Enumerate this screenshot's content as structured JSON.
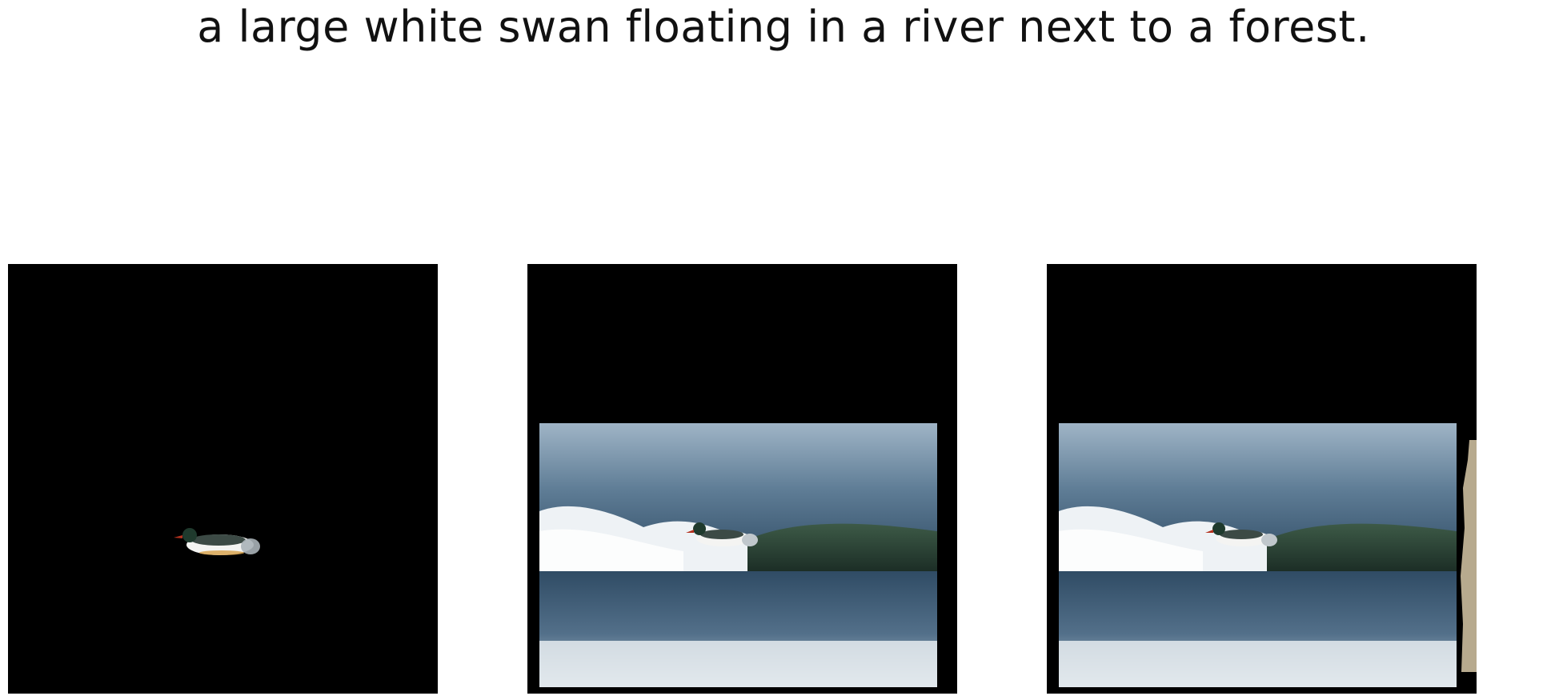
{
  "caption": "a large white swan floating in a river next to a forest.",
  "panels": [
    {
      "content": "segmented bird on black background"
    },
    {
      "content": "bird on breaking wave, padded image"
    },
    {
      "content": "bird on breaking wave, padded image with edge artifact"
    }
  ],
  "colors": {
    "background": "#000000",
    "water_dark": "#2e4a63",
    "water_mid": "#5f7d96",
    "wave_green": "#2f4a36",
    "foam": "#eef2f5",
    "edge_strip": "#b7aa8e"
  }
}
